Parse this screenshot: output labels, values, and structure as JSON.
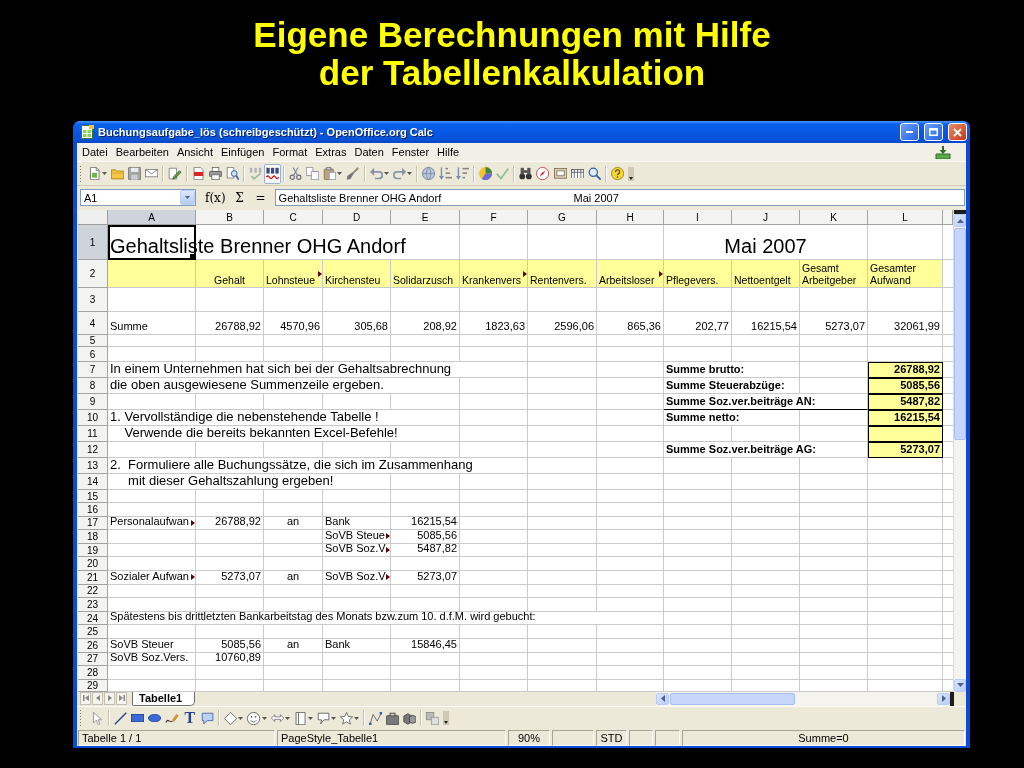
{
  "slide_title": [
    "Eigene Berechnungen mit Hilfe",
    "der Tabellenkalkulation"
  ],
  "window": {
    "title": "Buchungsaufgabe_lös (schreibgeschützt) - OpenOffice.org Calc"
  },
  "menu": [
    "Datei",
    "Bearbeiten",
    "Ansicht",
    "Einfügen",
    "Format",
    "Extras",
    "Daten",
    "Fenster",
    "Hilfe"
  ],
  "toolbar": {
    "auto_spellcheck_on": true
  },
  "formula_bar": {
    "cell_reference": "A1",
    "buttons": [
      "f(x)",
      "Σ",
      "="
    ],
    "content": [
      "Gehaltsliste Brenner OHG Andorf",
      "Mai 2007"
    ]
  },
  "sheet": {
    "columns": [
      {
        "label": "A",
        "selected": true
      },
      {
        "label": "B",
        "selected": false
      },
      {
        "label": "C",
        "selected": false
      },
      {
        "label": "D",
        "selected": false
      },
      {
        "label": "E",
        "selected": false
      },
      {
        "label": "F",
        "selected": false
      },
      {
        "label": "G",
        "selected": false
      },
      {
        "label": "H",
        "selected": false
      },
      {
        "label": "I",
        "selected": false
      },
      {
        "label": "J",
        "selected": false
      },
      {
        "label": "K",
        "selected": false
      },
      {
        "label": "L",
        "selected": false
      }
    ],
    "rows": [
      {
        "number": "1",
        "selected": true,
        "cells": {
          "A": {
            "kind": "title",
            "text": "Gehaltsliste Brenner OHG Andorf",
            "clipped": false
          },
          "J": {
            "kind": "date",
            "text": "Mai 2007",
            "clipped": false
          }
        }
      },
      {
        "number": "2",
        "selected": false,
        "cells": {
          "A": {
            "kind": "header",
            "clipped": false
          },
          "B": {
            "kind": "centered_header",
            "text": "Gehalt",
            "clipped": false
          },
          "C": {
            "kind": "header",
            "text": "Lohnsteue",
            "clipped": true
          },
          "D": {
            "kind": "header",
            "text": "Kirchensteu",
            "clipped": false
          },
          "E": {
            "kind": "header",
            "text": "Solidarzusch",
            "clipped": false
          },
          "F": {
            "kind": "header",
            "text": "Krankenvers",
            "clipped": true
          },
          "G": {
            "kind": "header",
            "text": "Rentenvers.",
            "clipped": false
          },
          "H": {
            "kind": "header",
            "text": "Arbeitsloser",
            "clipped": true
          },
          "I": {
            "kind": "header",
            "text": "Pflegevers.",
            "clipped": false
          },
          "J": {
            "kind": "header",
            "text": "Nettoentgelt",
            "clipped": false
          },
          "K": {
            "kind": "header",
            "text": "Gesamt Arbeitgeber",
            "clipped": false
          },
          "L": {
            "kind": "header",
            "text": "Gesamter Aufwand",
            "clipped": false
          }
        }
      },
      {
        "number": "3",
        "selected": false
      },
      {
        "number": "4",
        "selected": false,
        "cells": {
          "A": {
            "kind": "label",
            "text": "Summe",
            "clipped": false
          },
          "B": {
            "kind": "amount",
            "text": "26788,92",
            "clipped": false
          },
          "C": {
            "kind": "amount",
            "text": "4570,96",
            "clipped": false
          },
          "D": {
            "kind": "amount",
            "text": "305,68",
            "clipped": false
          },
          "E": {
            "kind": "amount",
            "text": "208,92",
            "clipped": false
          },
          "F": {
            "kind": "amount",
            "text": "1823,63",
            "clipped": false
          },
          "G": {
            "kind": "amount",
            "text": "2596,06",
            "clipped": false
          },
          "H": {
            "kind": "amount",
            "text": "865,36",
            "clipped": false
          },
          "I": {
            "kind": "amount",
            "text": "202,77",
            "clipped": false
          },
          "J": {
            "kind": "amount",
            "text": "16215,54",
            "clipped": false
          },
          "K": {
            "kind": "amount",
            "text": "5273,07",
            "clipped": false
          },
          "L": {
            "kind": "amount",
            "text": "32061,99",
            "clipped": false
          }
        }
      },
      {
        "number": "5",
        "selected": false
      },
      {
        "number": "6",
        "selected": false
      },
      {
        "number": "7",
        "selected": false,
        "cells": {
          "A": {
            "kind": "task",
            "text": "In einem Unternehmen hat sich bei der Gehaltsabrechnung",
            "clipped": false
          },
          "I": {
            "kind": "total_label",
            "text": "Summe brutto:",
            "clipped": false
          },
          "L": {
            "kind": "total",
            "text": "26788,92",
            "clipped": false
          }
        }
      },
      {
        "number": "8",
        "selected": false,
        "cells": {
          "A": {
            "kind": "task",
            "text": "die oben ausgewiesene Summenzeile ergeben.",
            "clipped": false
          },
          "I": {
            "kind": "total_label",
            "text": "Summe Steuerabzüge:",
            "clipped": false
          },
          "L": {
            "kind": "total",
            "text": "5085,56",
            "clipped": false
          }
        }
      },
      {
        "number": "9",
        "selected": false,
        "cells": {
          "I": {
            "kind": "subtotal_label",
            "text": "Summe Soz.ver.beiträge AN:",
            "clipped": false
          },
          "L": {
            "kind": "total",
            "text": "5487,82",
            "clipped": false
          }
        }
      },
      {
        "number": "10",
        "selected": false,
        "cells": {
          "A": {
            "kind": "task",
            "text": "1. Vervollständige die nebenstehende Tabelle !",
            "clipped": false
          },
          "I": {
            "kind": "total_label",
            "text": "Summe netto:",
            "clipped": false
          },
          "L": {
            "kind": "total",
            "text": "16215,54",
            "clipped": false
          }
        }
      },
      {
        "number": "11",
        "selected": false,
        "cells": {
          "A": {
            "kind": "task",
            "text": "    Verwende die bereits bekannten Excel-Befehle!",
            "clipped": false
          },
          "L": {
            "kind": "total",
            "clipped": false
          }
        }
      },
      {
        "number": "12",
        "selected": false,
        "cells": {
          "I": {
            "kind": "total_label",
            "text": "Summe Soz.ver.beiträge AG:",
            "clipped": false
          },
          "L": {
            "kind": "total",
            "text": "5273,07",
            "clipped": false
          }
        }
      },
      {
        "number": "13",
        "selected": false,
        "cells": {
          "A": {
            "kind": "task",
            "text": "2.  Formuliere alle Buchungssätze, die sich im Zusammenhang",
            "clipped": false
          }
        }
      },
      {
        "number": "14",
        "selected": false,
        "cells": {
          "A": {
            "kind": "task",
            "text": "     mit dieser Gehaltszahlung ergeben!",
            "clipped": false
          }
        }
      },
      {
        "number": "15",
        "selected": false
      },
      {
        "number": "16",
        "selected": false
      },
      {
        "number": "17",
        "selected": false,
        "cells": {
          "A": {
            "kind": "label",
            "text": "Personalaufwan",
            "clipped": true
          },
          "B": {
            "kind": "amount",
            "text": "26788,92",
            "clipped": false
          },
          "C": {
            "kind": "connector",
            "text": "an",
            "clipped": false
          },
          "D": {
            "kind": "label",
            "text": "Bank",
            "clipped": false
          },
          "E": {
            "kind": "amount",
            "text": "16215,54",
            "clipped": false
          }
        }
      },
      {
        "number": "18",
        "selected": false,
        "cells": {
          "D": {
            "kind": "label",
            "text": "SoVB Steue",
            "clipped": true
          },
          "E": {
            "kind": "amount",
            "text": "5085,56",
            "clipped": false
          }
        }
      },
      {
        "number": "19",
        "selected": false,
        "cells": {
          "D": {
            "kind": "label",
            "text": "SoVB Soz.V",
            "clipped": true
          },
          "E": {
            "kind": "amount",
            "text": "5487,82",
            "clipped": false
          }
        }
      },
      {
        "number": "20",
        "selected": false
      },
      {
        "number": "21",
        "selected": false,
        "cells": {
          "A": {
            "kind": "label",
            "text": "Sozialer Aufwan",
            "clipped": true
          },
          "B": {
            "kind": "amount",
            "text": "5273,07",
            "clipped": false
          },
          "C": {
            "kind": "connector",
            "text": "an",
            "clipped": false
          },
          "D": {
            "kind": "label",
            "text": "SoVB Soz.V",
            "clipped": true
          },
          "E": {
            "kind": "amount",
            "text": "5273,07",
            "clipped": false
          }
        }
      },
      {
        "number": "22",
        "selected": false
      },
      {
        "number": "23",
        "selected": false
      },
      {
        "number": "24",
        "selected": false,
        "cells": {
          "A": {
            "kind": "label",
            "text": "Spätestens bis drittletzten Bankarbeitstag des Monats bzw.zum 10. d.f.M. wird gebucht:",
            "clipped": false
          }
        }
      },
      {
        "number": "25",
        "selected": false
      },
      {
        "number": "26",
        "selected": false,
        "cells": {
          "A": {
            "kind": "label",
            "text": "SoVB Steuer",
            "clipped": false
          },
          "B": {
            "kind": "amount",
            "text": "5085,56",
            "clipped": false
          },
          "C": {
            "kind": "connector",
            "text": "an",
            "clipped": false
          },
          "D": {
            "kind": "label",
            "text": "Bank",
            "clipped": false
          },
          "E": {
            "kind": "amount",
            "text": "15846,45",
            "clipped": false
          }
        }
      },
      {
        "number": "27",
        "selected": false,
        "cells": {
          "A": {
            "kind": "label",
            "text": "SoVB Soz.Vers.",
            "clipped": false
          },
          "B": {
            "kind": "amount",
            "text": "10760,89",
            "clipped": false
          }
        }
      },
      {
        "number": "28",
        "selected": false
      },
      {
        "number": "29",
        "selected": false
      }
    ]
  },
  "sheet_tabs": [
    {
      "label": "Tabelle1",
      "selected": true
    }
  ],
  "drawing_toolbar": {
    "text_tool": "T"
  },
  "status_bar": [
    {
      "kind": "label",
      "text": "Tabelle 1 / 1"
    },
    {
      "kind": "label",
      "text": "PageStyle_Tabelle1"
    },
    {
      "kind": "indicator",
      "text": "90%"
    },
    {
      "kind": "blank"
    },
    {
      "kind": "indicator",
      "text": "STD"
    },
    {
      "kind": "blank"
    },
    {
      "kind": "blank"
    },
    {
      "kind": "indicator",
      "text": "Summe=0"
    }
  ]
}
